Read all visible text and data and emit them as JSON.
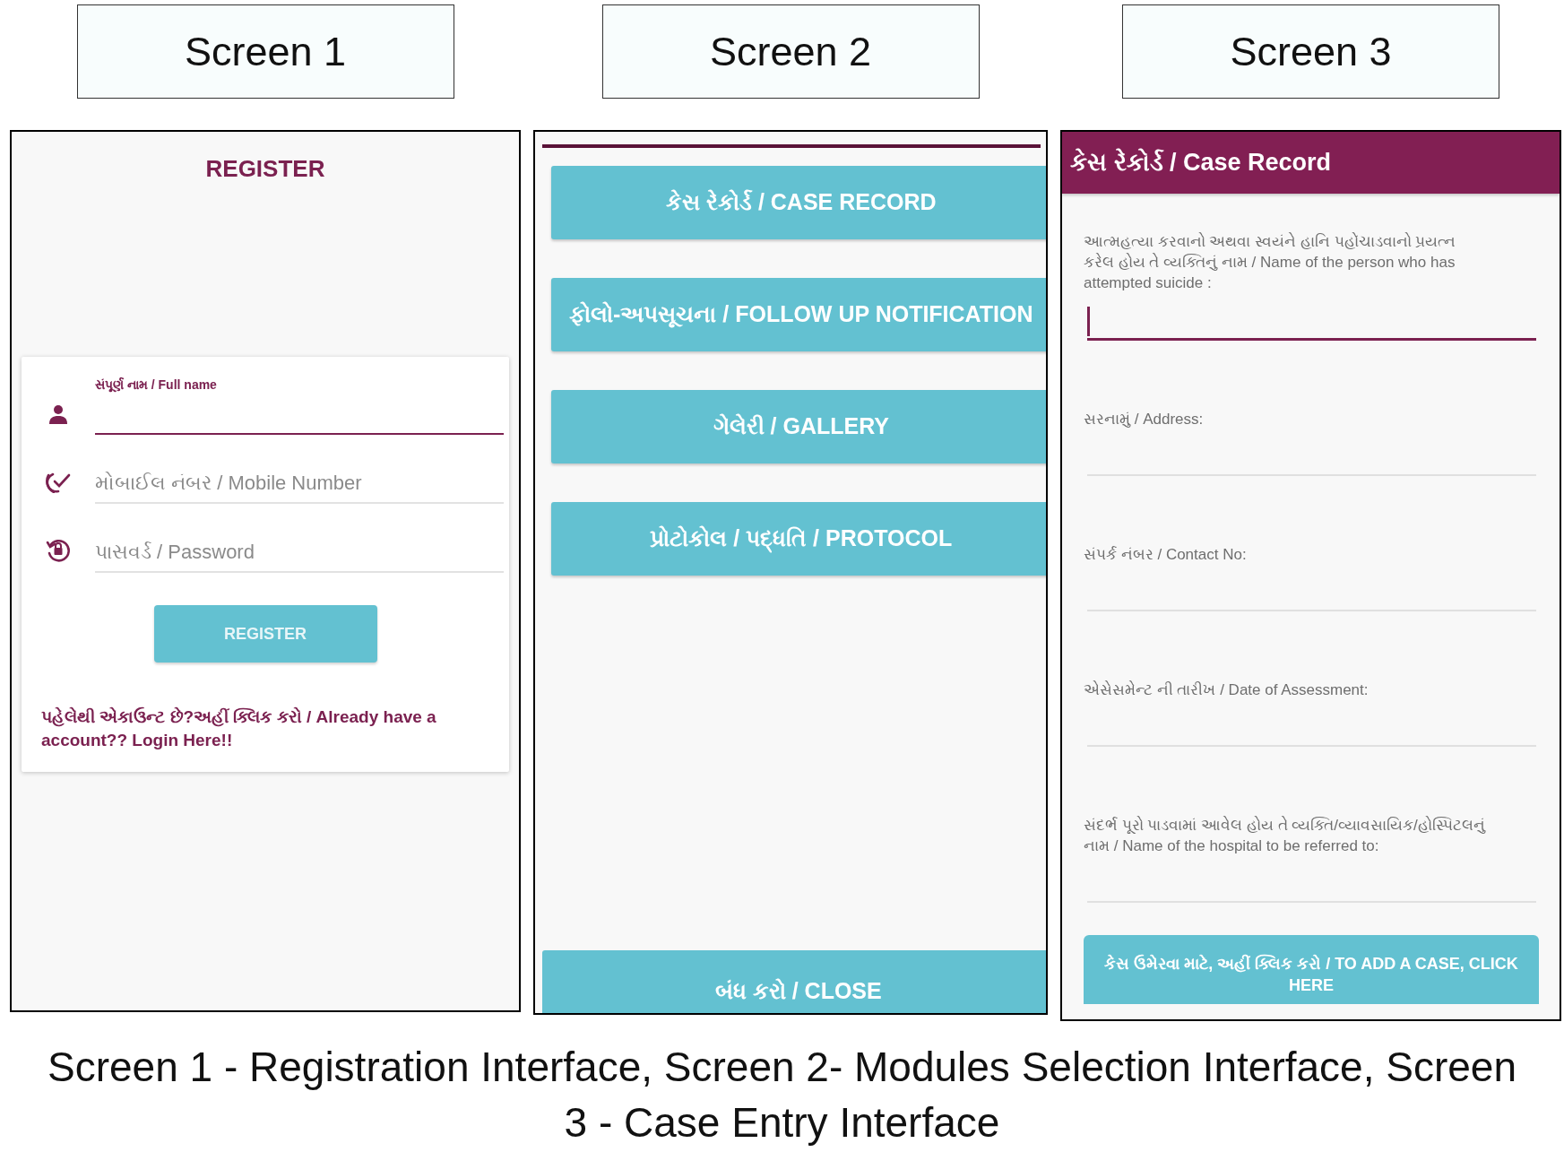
{
  "screen_labels": [
    "Screen 1",
    "Screen 2",
    "Screen 3"
  ],
  "screen_1": {
    "title": "REGISTER",
    "fields": [
      {
        "label": "સંપૂર્ણ નામ / Full name",
        "focused": true
      },
      {
        "placeholder": "મોબાઈલ નંબર / Mobile Number",
        "focused": false
      },
      {
        "placeholder": "પાસવર્ડ / Password",
        "focused": false
      }
    ],
    "button": "REGISTER",
    "login_link": "પહેલેથી એકાઉન્ટ છે?અહીં ક્લિક કરો / Already have a account?? Login Here!!"
  },
  "screen_2": {
    "menu_buttons": [
      "કેસ રેકોર્ડ / CASE RECORD",
      "ફોલો-અપસૂચના / FOLLOW UP NOTIFICATION",
      "ગેલેરી / GALLERY",
      "પ્રોટોકોલ / પદ્ધતિ / PROTOCOL"
    ],
    "close_button": "બંધ કરો / CLOSE"
  },
  "screen_3": {
    "title": "કેસ રેકોર્ડ / Case Record",
    "fields": [
      {
        "label": "આત્મહત્યા કરવાનો અથવા સ્વયંને હાનિ પહોંચાડવાનો પ્રયત્ન કરેલ હોય તે વ્યક્તિનું નામ / Name of the person who has attempted suicide :",
        "focused": true
      },
      {
        "label": "સરનામું / Address:",
        "focused": false
      },
      {
        "label": "સંપર્ક નંબર / Contact No:",
        "focused": false
      },
      {
        "label": "એસેસમેન્ટ ની તારીખ / Date of Assessment:",
        "focused": false
      },
      {
        "label": "સંદર્ભ પૂરો પાડવામાં આવેલ હોય તે વ્યક્તિ/વ્યાવસાયિક/હોસ્પિટલનું નામ / Name of the hospital to be referred to:",
        "focused": false
      }
    ],
    "button": "કેસ ઉમેરવા માટે, અહીં ક્લિક કરો / TO ADD A CASE, CLICK HERE"
  },
  "caption": "Screen 1 - Registration Interface, Screen 2- Modules Selection Interface, Screen 3 - Case Entry Interface"
}
